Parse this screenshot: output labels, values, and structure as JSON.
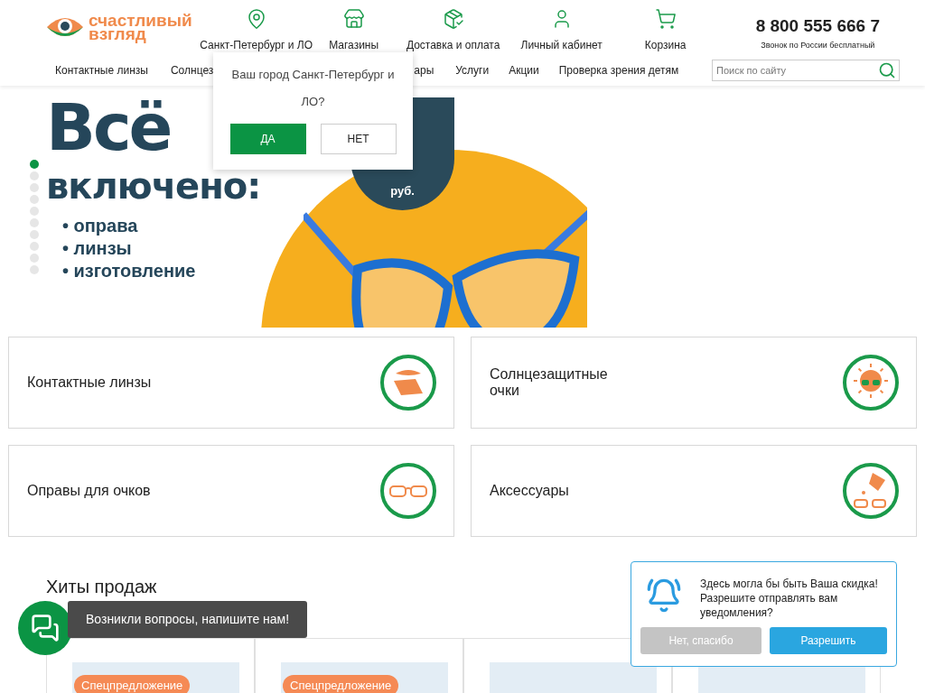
{
  "logo": {
    "line1": "счастливый",
    "line2": "взгляд"
  },
  "top_links": [
    {
      "label": "Санкт-Петербург и ЛО",
      "kind": "pin"
    },
    {
      "label": "Магазины",
      "kind": "shop"
    },
    {
      "label": "Доставка и оплата",
      "kind": "delivery"
    },
    {
      "label": "Личный кабинет",
      "kind": "user"
    },
    {
      "label": "Корзина",
      "kind": "cart"
    }
  ],
  "phone": {
    "number": "8 800 555 666 7",
    "note": "Звонок по России бесплатный"
  },
  "nav": [
    "Контактные линзы",
    "Солнцез",
    "ары",
    "Услуги",
    "Акции",
    "Проверка зрения детям"
  ],
  "search": {
    "placeholder": "Поиск по сайту"
  },
  "city_popup": {
    "question": "Ваш город Санкт-Петербург и ЛО?",
    "yes": "ДА",
    "no": "НЕТ"
  },
  "banner": {
    "title1": "Всё",
    "title2": "включено:",
    "bullets": [
      "• оправа",
      "• линзы",
      "• изготовление"
    ],
    "currency": "руб.",
    "slides": [
      {
        "selected": true
      },
      {
        "selected": false
      },
      {
        "selected": false
      },
      {
        "selected": false
      },
      {
        "selected": false
      },
      {
        "selected": false
      },
      {
        "selected": false
      },
      {
        "selected": false
      },
      {
        "selected": false
      },
      {
        "selected": false
      }
    ]
  },
  "categories": [
    {
      "label": "Контактные линзы",
      "kind": "lens"
    },
    {
      "label": "Солнцезащитные очки",
      "kind": "sun"
    },
    {
      "label": "Оправы для очков",
      "kind": "frames"
    },
    {
      "label": "Аксессуары",
      "kind": "accessories"
    }
  ],
  "hits": {
    "title": "Хиты продаж",
    "products": [
      {
        "special": true,
        "badge": "Спецпредложение"
      },
      {
        "special": true,
        "badge": "Спецпредложение"
      },
      {
        "special": false
      },
      {
        "special": false
      }
    ]
  },
  "chat": {
    "text": "Возникли вопросы, напишите нам!"
  },
  "push": {
    "text": "Здесь могла бы быть Ваша скидка! Разрешите отправлять вам уведомления?",
    "deny": "Нет, спасибо",
    "allow": "Разрешить"
  }
}
